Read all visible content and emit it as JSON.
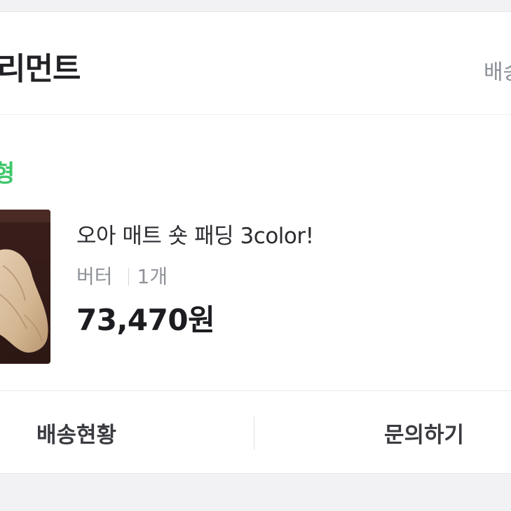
{
  "header": {
    "shop_name": "리먼트",
    "link_text": "배송"
  },
  "order": {
    "status": "형",
    "product_name": "오아 매트 숏 패딩 3color!",
    "option": "버터",
    "quantity": "1개",
    "price": "73,470원"
  },
  "actions": {
    "tracking_label": "배송현황",
    "inquiry_label": "문의하기"
  },
  "colors": {
    "status_green": "#3ec66b",
    "text_dark": "#1d1d21",
    "text_muted": "#8f9399",
    "background": "#f2f2f4"
  }
}
